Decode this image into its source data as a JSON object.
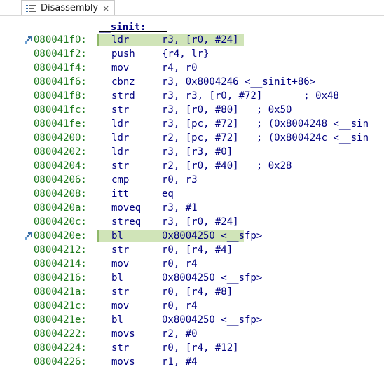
{
  "tab": {
    "label": "Disassembly",
    "close": "×"
  },
  "function_label": "__sinit:",
  "highlight_color": "#d0e4b8",
  "rows": [
    {
      "addr": "080041f0:",
      "mnem": "ldr",
      "ops": "r3, [r0, #24]",
      "highlight": true,
      "marker": true
    },
    {
      "addr": "080041f2:",
      "mnem": "push",
      "ops": "{r4, lr}"
    },
    {
      "addr": "080041f4:",
      "mnem": "mov",
      "ops": "r4, r0"
    },
    {
      "addr": "080041f6:",
      "mnem": "cbnz",
      "ops": "r3, 0x8004246 <__sinit+86>"
    },
    {
      "addr": "080041f8:",
      "mnem": "strd",
      "ops": "r3, r3, [r0, #72]       ; 0x48"
    },
    {
      "addr": "080041fc:",
      "mnem": "str",
      "ops": "r3, [r0, #80]   ; 0x50"
    },
    {
      "addr": "080041fe:",
      "mnem": "ldr",
      "ops": "r3, [pc, #72]   ; (0x8004248 <__sin"
    },
    {
      "addr": "08004200:",
      "mnem": "ldr",
      "ops": "r2, [pc, #72]   ; (0x800424c <__sin"
    },
    {
      "addr": "08004202:",
      "mnem": "ldr",
      "ops": "r3, [r3, #0]"
    },
    {
      "addr": "08004204:",
      "mnem": "str",
      "ops": "r2, [r0, #40]   ; 0x28"
    },
    {
      "addr": "08004206:",
      "mnem": "cmp",
      "ops": "r0, r3"
    },
    {
      "addr": "08004208:",
      "mnem": "itt",
      "ops": "eq"
    },
    {
      "addr": "0800420a:",
      "mnem": "moveq",
      "ops": "r3, #1"
    },
    {
      "addr": "0800420c:",
      "mnem": "streq",
      "ops": "r3, [r0, #24]"
    },
    {
      "addr": "0800420e:",
      "mnem": "bl",
      "ops": "0x8004250 <__sfp>",
      "highlight": true,
      "marker": true
    },
    {
      "addr": "08004212:",
      "mnem": "str",
      "ops": "r0, [r4, #4]"
    },
    {
      "addr": "08004214:",
      "mnem": "mov",
      "ops": "r0, r4"
    },
    {
      "addr": "08004216:",
      "mnem": "bl",
      "ops": "0x8004250 <__sfp>"
    },
    {
      "addr": "0800421a:",
      "mnem": "str",
      "ops": "r0, [r4, #8]"
    },
    {
      "addr": "0800421c:",
      "mnem": "mov",
      "ops": "r0, r4"
    },
    {
      "addr": "0800421e:",
      "mnem": "bl",
      "ops": "0x8004250 <__sfp>"
    },
    {
      "addr": "08004222:",
      "mnem": "movs",
      "ops": "r2, #0"
    },
    {
      "addr": "08004224:",
      "mnem": "str",
      "ops": "r0, [r4, #12]"
    },
    {
      "addr": "08004226:",
      "mnem": "movs",
      "ops": "r1, #4"
    }
  ]
}
